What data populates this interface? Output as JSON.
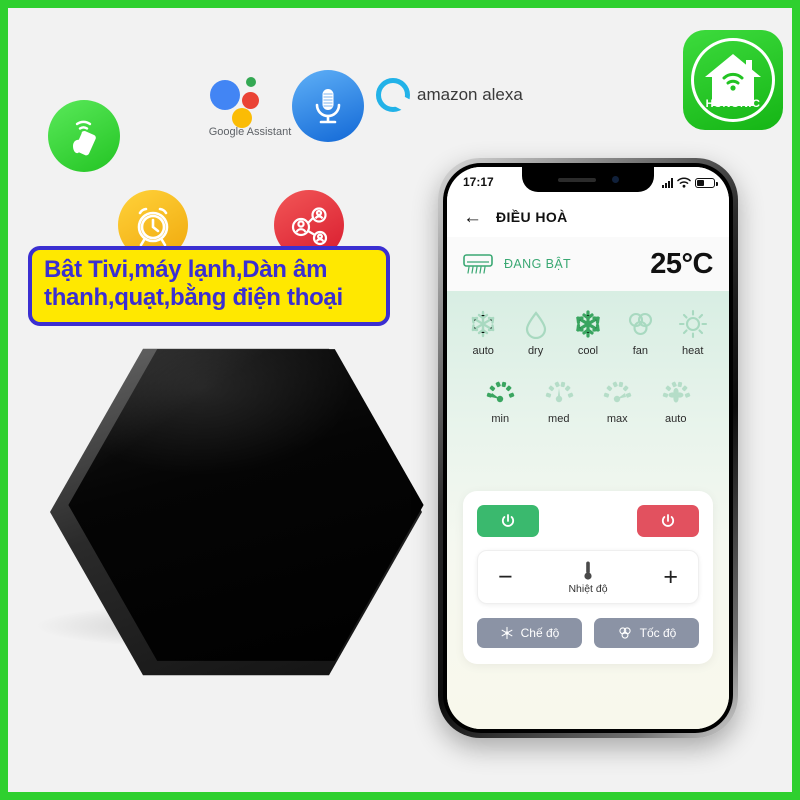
{
  "poster": {
    "background_color": "#f2f2f2",
    "border_color": "#2fd02f"
  },
  "brand": {
    "name": "HUNONIC",
    "logo_icon": "house-wifi-icon",
    "background_color": "#2fd02f"
  },
  "promo_banner": {
    "line1": "Bật Tivi,máy lạnh,Dàn âm",
    "line2": "thanh,quạt,bằng điện thoại",
    "text_color": "#3b2fd1",
    "background_color": "#ffe800",
    "border_color": "#3b2fd1"
  },
  "badges": [
    {
      "id": "phone-control",
      "icon": "hand-holding-phone-wifi-icon",
      "color": "#2fd02f"
    },
    {
      "id": "timer",
      "icon": "alarm-clock-icon",
      "color": "#f0a80c"
    },
    {
      "id": "sharing",
      "icon": "share-users-network-icon",
      "color": "#d81b2e"
    }
  ],
  "assistants": [
    {
      "id": "google-assistant",
      "label": "Google Assistant",
      "icon": "google-assistant-dots-icon"
    },
    {
      "id": "voice-mic",
      "label": "",
      "icon": "microphone-icon"
    },
    {
      "id": "amazon-alexa",
      "label": "amazon alexa",
      "icon": "alexa-ring-icon"
    }
  ],
  "device": {
    "name": "hexagon-ir-blaster",
    "color": "#000000"
  },
  "phone": {
    "statusbar": {
      "time": "17:17",
      "signal_icon": "signal-bars-icon",
      "wifi_icon": "wifi-icon",
      "battery_icon": "battery-icon"
    },
    "appbar": {
      "back_icon": "back-arrow-icon",
      "title": "ĐIỀU HOÀ"
    },
    "status_row": {
      "device_icon": "air-conditioner-icon",
      "state_text": "ĐANG BẬT",
      "state_color": "#3aa873",
      "temperature": "25°C"
    },
    "modes": [
      {
        "label": "auto",
        "icon": "snowflake-icon",
        "active": false
      },
      {
        "label": "dry",
        "icon": "water-drop-icon",
        "active": false
      },
      {
        "label": "cool",
        "icon": "snowflake-icon",
        "active": true
      },
      {
        "label": "fan",
        "icon": "fan-blades-icon",
        "active": false
      },
      {
        "label": "heat",
        "icon": "sun-icon",
        "active": false
      }
    ],
    "speeds": [
      {
        "label": "min",
        "icon": "gauge-icon",
        "active": true
      },
      {
        "label": "med",
        "icon": "gauge-icon",
        "active": false
      },
      {
        "label": "max",
        "icon": "gauge-icon",
        "active": false
      },
      {
        "label": "auto",
        "icon": "gauge-fan-icon",
        "active": false
      }
    ],
    "controls": {
      "power_on_icon": "power-icon",
      "power_on_color": "#3ab96e",
      "power_off_icon": "power-icon",
      "power_off_color": "#e2515f",
      "minus_label": "−",
      "plus_label": "+",
      "temp_label": "Nhiệt độ",
      "temp_icon": "thermometer-icon",
      "mode_chip_label": "Chế độ",
      "mode_chip_icon": "snowflake-sun-icon",
      "speed_chip_label": "Tốc độ",
      "speed_chip_icon": "fan-blades-icon",
      "chip_color": "#8b93a5"
    }
  }
}
